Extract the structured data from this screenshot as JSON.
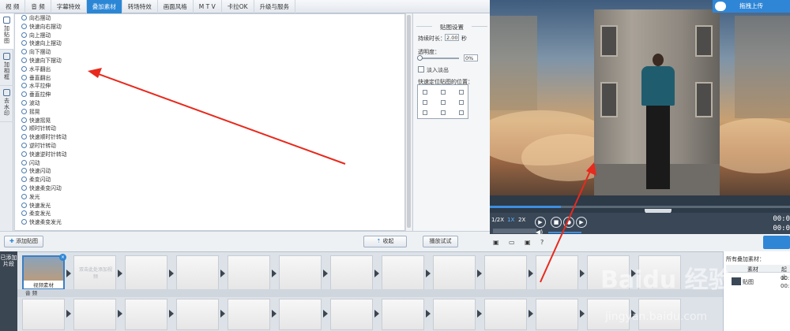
{
  "tabs": [
    "视  频",
    "音  频",
    "字幕特效",
    "叠加素材",
    "转场特效",
    "画面风格",
    "M T V",
    "卡拉OK",
    "升级与服务"
  ],
  "active_tab": 3,
  "side_tabs": [
    {
      "label": "加贴图",
      "icon": "sticker-icon"
    },
    {
      "label": "加相框",
      "icon": "frame-icon"
    },
    {
      "label": "去水印",
      "icon": "watermark-icon"
    }
  ],
  "effects": [
    "向右摆动",
    "快速向右摆动",
    "向上摆动",
    "快速向上摆动",
    "向下摆动",
    "快速向下摆动",
    "水平翻出",
    "垂直翻出",
    "水平拉伸",
    "垂直拉伸",
    "波动",
    "摇晃",
    "快速摇晃",
    "顺时针转动",
    "快速顺时针转动",
    "逆时针转动",
    "快速逆时针转动",
    "闪动",
    "快速闪动",
    "柔变闪动",
    "快速柔变闪动",
    "发光",
    "快速发光",
    "柔变发光",
    "快速柔变发光"
  ],
  "settings": {
    "title": "贴图设置",
    "duration_label": "持续时长：",
    "duration_value": "2.00",
    "duration_unit": "秒",
    "opacity_label": "透明度：",
    "opacity_value": "0%",
    "fade_label": "淡入淡出",
    "position_label": "快速定位贴图的位置："
  },
  "buttons": {
    "add_sticker": "添加贴图",
    "collapse": "收起",
    "preview_play": "播放试试",
    "upload": "拖拽上传"
  },
  "player": {
    "speeds": [
      "1/2X",
      "1X",
      "2X"
    ],
    "active_speed": "1X",
    "time_top": "00:0",
    "time_bottom": "00:0"
  },
  "timeline": {
    "side_label": "已添加片段",
    "clip1_label": "视频素材",
    "clip2_label": "双击此处添加视频",
    "audio_label": "音  频"
  },
  "material_panel": {
    "title": "所有叠加素材：",
    "col1": "素材",
    "col2": "起止",
    "row_label": "贴图",
    "row_val1": "00:",
    "row_val2": "00:"
  },
  "watermark": "Baidu 经验",
  "watermark_url": "jingyan.baidu.com",
  "colors": {
    "accent": "#2b86d6",
    "arrow": "#e8291d"
  }
}
